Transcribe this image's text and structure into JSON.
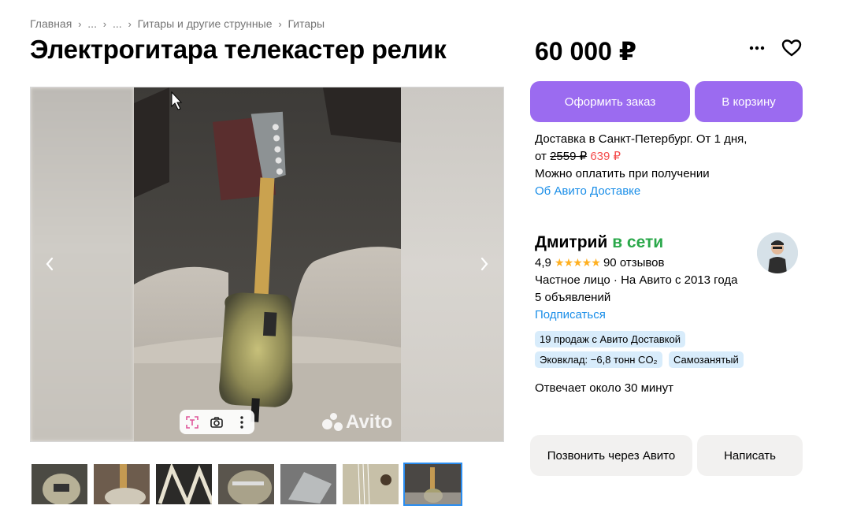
{
  "breadcrumb": {
    "items": [
      "Главная",
      "...",
      "...",
      "Гитары и другие струнные",
      "Гитары"
    ],
    "separator": "›"
  },
  "listing": {
    "title": "Электрогитара телекастер релик",
    "price": "60 000 ₽"
  },
  "actions": {
    "more_icon": "more-dots-icon",
    "favorite_icon": "heart-icon",
    "order_label": "Оформить заказ",
    "cart_label": "В корзину",
    "call_label": "Позвонить через Авито",
    "message_label": "Написать"
  },
  "delivery": {
    "line1": "Доставка в Санкт-Петербург. От 1 дня,",
    "from_prefix": "от",
    "old_price": "2559 ₽",
    "new_price": "639 ₽",
    "payment": "Можно оплатить при получении",
    "about_link": "Об Авито Доставке",
    "discount_color": "#f44c4c"
  },
  "seller": {
    "name": "Дмитрий",
    "status": "в сети",
    "rating": "4,9",
    "stars": "★★★★★",
    "reviews": "90 отзывов",
    "type": "Частное лицо · На Авито с 2013 года",
    "ads": "5 объявлений",
    "subscribe": "Подписаться",
    "badges": [
      "19 продаж с Авито Доставкой",
      "Эковклад: −6,8 тонн CO₂",
      "Самозанятый"
    ],
    "response": "Отвечает около 30 минут"
  },
  "gallery": {
    "watermark": "Avito",
    "prev_icon": "chevron-left-icon",
    "next_icon": "chevron-right-icon",
    "tools": [
      "text-recognition-icon",
      "camera-search-icon",
      "more-vertical-icon"
    ],
    "thumbnail_count": 7,
    "active_thumbnail": 7
  },
  "colors": {
    "primary": "#9b6bf0",
    "link": "#1a8ee8",
    "online": "#2aa84a",
    "badge_bg": "#d8ecfb"
  }
}
